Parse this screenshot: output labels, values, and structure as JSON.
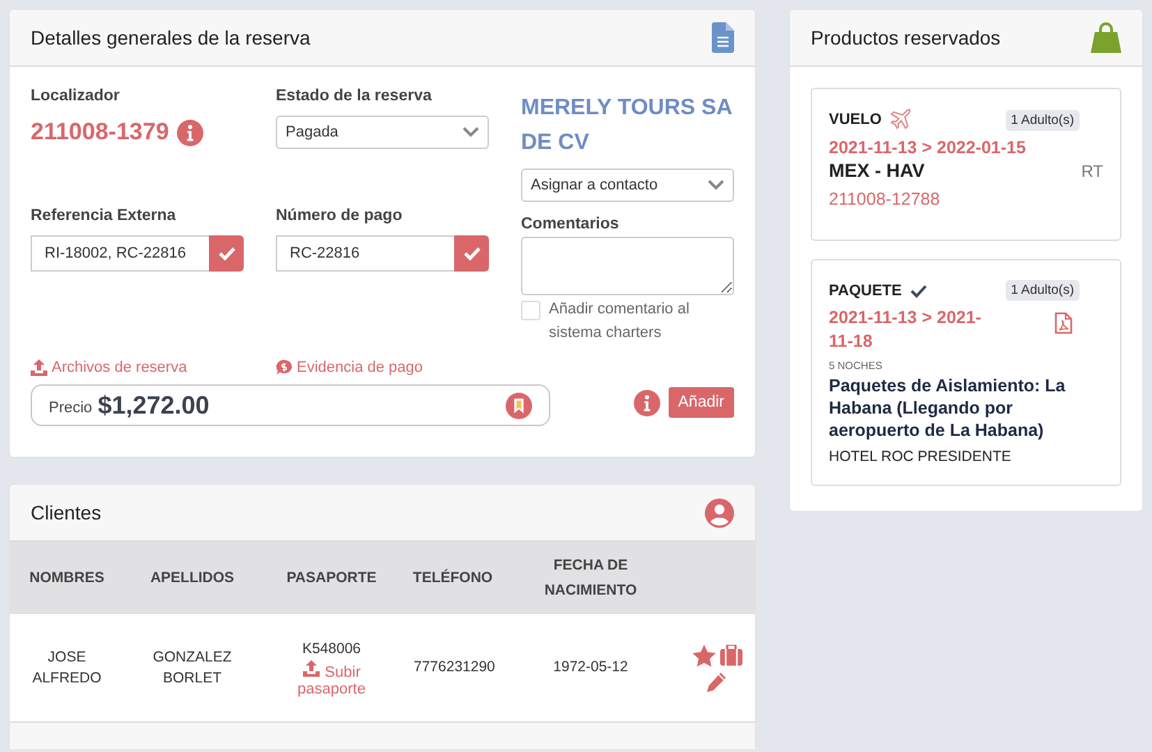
{
  "details": {
    "title": "Detalles generales de la reserva",
    "locator_label": "Localizador",
    "locator": "211008-1379",
    "status_label": "Estado de la reserva",
    "status_value": "Pagada",
    "agency": "MERELY TOURS SA DE CV",
    "contact_select": "Asignar a contacto",
    "external_ref_label": "Referencia Externa",
    "external_ref": "RI-18002, RC-22816",
    "payment_label": "Número de pago",
    "payment": "RC-22816",
    "comments_label": "Comentarios",
    "comment_checkbox": {
      "label": "Añadir comentario al sistema charters",
      "checked": false
    },
    "files_link": "Archivos de reserva",
    "evidence_link": "Evidencia de pago",
    "price_label": "Precio",
    "price": "$1,272.00",
    "add_button": "Añadir"
  },
  "clients": {
    "title": "Clientes",
    "columns": [
      "NOMBRES",
      "APELLIDOS",
      "PASAPORTE",
      "TELÉFONO",
      "FECHA DE NACIMIENTO"
    ],
    "rows": [
      {
        "nombres": "JOSE ALFREDO",
        "apellidos": "GONZALEZ BORLET",
        "pasaporte": "K548006",
        "upload_link": "Subir pasaporte",
        "telefono": "7776231290",
        "fecha": "1972-05-12"
      }
    ]
  },
  "products": {
    "title": "Productos reservados",
    "items": [
      {
        "kind": "flight",
        "type_label": "VUELO",
        "pax": "1 Adulto(s)",
        "dates": "2021-11-13 > 2022-01-15",
        "route": "MEX - HAV",
        "trip": "RT",
        "code": "211008-12788"
      },
      {
        "kind": "package",
        "type_label": "PAQUETE",
        "pax": "1 Adulto(s)",
        "dates": "2021-11-13 > 2021-11-18",
        "nights": "5 NOCHES",
        "name": "Paquetes de Aislamiento: La Habana (Llegando por aeropuerto de La Habana)",
        "hotel": "HOTEL ROC PRESIDENTE"
      }
    ]
  }
}
